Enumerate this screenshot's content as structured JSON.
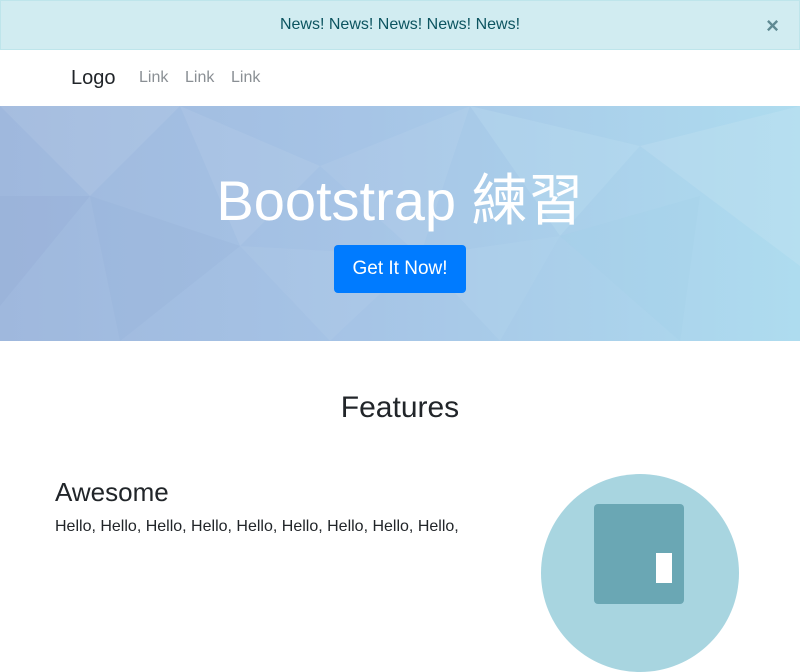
{
  "alert": {
    "text": "News! News! News! News! News!",
    "close_label": "×"
  },
  "navbar": {
    "brand": "Logo",
    "links": [
      "Link",
      "Link",
      "Link"
    ]
  },
  "hero": {
    "title": "Bootstrap 練習",
    "button_label": "Get It Now!"
  },
  "features": {
    "title": "Features",
    "items": [
      {
        "heading": "Awesome",
        "text": "Hello, Hello, Hello, Hello, Hello, Hello, Hello, Hello, Hello,"
      }
    ]
  },
  "colors": {
    "alert_bg": "#d1ecf1",
    "alert_text": "#0c5460",
    "primary": "#007bff",
    "hero_start": "#9fb8dd",
    "hero_end": "#aedcef"
  }
}
